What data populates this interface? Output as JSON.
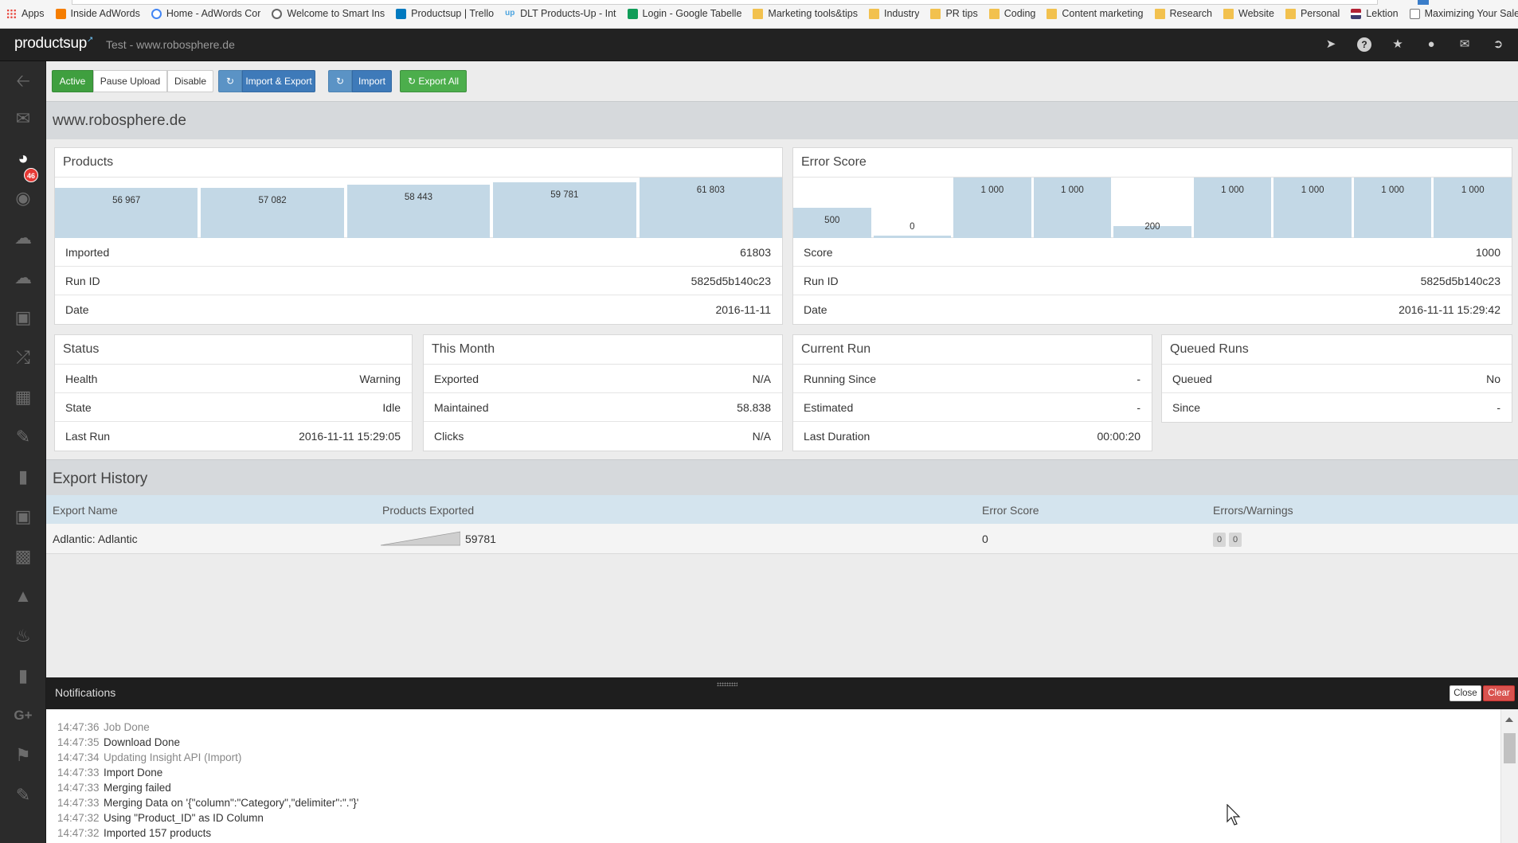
{
  "bookmarks": [
    {
      "label": "Apps",
      "icon": "apps-icon"
    },
    {
      "label": "Inside AdWords",
      "icon": "blogger-icon"
    },
    {
      "label": "Home - AdWords Cor",
      "icon": "google-icon"
    },
    {
      "label": "Welcome to Smart Ins",
      "icon": "smart-icon"
    },
    {
      "label": "Productsup | Trello",
      "icon": "trello-icon"
    },
    {
      "label": "DLT Products-Up - Int",
      "icon": "productsup-icon"
    },
    {
      "label": "Login - Google Tabelle",
      "icon": "sheets-icon"
    },
    {
      "label": "Marketing tools&tips",
      "icon": "folder-icon"
    },
    {
      "label": "Industry",
      "icon": "folder-icon"
    },
    {
      "label": "PR tips",
      "icon": "folder-icon"
    },
    {
      "label": "Coding",
      "icon": "folder-icon"
    },
    {
      "label": "Content marketing",
      "icon": "folder-icon"
    },
    {
      "label": "Research",
      "icon": "folder-icon"
    },
    {
      "label": "Website",
      "icon": "folder-icon"
    },
    {
      "label": "Personal",
      "icon": "folder-icon"
    },
    {
      "label": "Lektion",
      "icon": "flag-icon"
    },
    {
      "label": "Maximizing Your Sale",
      "icon": "document-icon"
    }
  ],
  "app": {
    "logo": "productsup",
    "logo_mark": "↗",
    "subtitle": "Test - www.robosphere.de",
    "top_icons": [
      "location-arrow-icon",
      "help-icon",
      "star-icon",
      "user-icon",
      "mail-icon",
      "logout-icon"
    ]
  },
  "sidebar": {
    "items": [
      "back-arrow-icon",
      "mail-icon",
      "dashboard-icon",
      "lock-icon",
      "cloud-download-icon",
      "cloud-upload-icon",
      "image-icon",
      "shuffle-icon",
      "table-icon",
      "pencil-icon",
      "book-icon",
      "money-icon",
      "bar-chart-icon",
      "warning-icon",
      "bell-icon",
      "book-alt-icon",
      "google-plus-icon",
      "flag-icon",
      "edit-icon"
    ],
    "mail_badge": "46"
  },
  "toolbar": {
    "active": "Active",
    "pause": "Pause Upload",
    "disable": "Disable",
    "import_export": "Import & Export",
    "import": "Import",
    "export_all": "Export All"
  },
  "site_title": "www.robosphere.de",
  "products": {
    "title": "Products",
    "rows": [
      {
        "k": "Imported",
        "v": "61803"
      },
      {
        "k": "Run ID",
        "v": "5825d5b140c23"
      },
      {
        "k": "Date",
        "v": "2016-11-11"
      }
    ]
  },
  "error_score": {
    "title": "Error Score",
    "rows": [
      {
        "k": "Score",
        "v": "1000"
      },
      {
        "k": "Run ID",
        "v": "5825d5b140c23"
      },
      {
        "k": "Date",
        "v": "2016-11-11 15:29:42"
      }
    ]
  },
  "status": {
    "title": "Status",
    "rows": [
      {
        "k": "Health",
        "v": "Warning"
      },
      {
        "k": "State",
        "v": "Idle"
      },
      {
        "k": "Last Run",
        "v": "2016-11-11 15:29:05"
      }
    ]
  },
  "this_month": {
    "title": "This Month",
    "rows": [
      {
        "k": "Exported",
        "v": "N/A"
      },
      {
        "k": "Maintained",
        "v": "58.838"
      },
      {
        "k": "Clicks",
        "v": "N/A"
      }
    ]
  },
  "current_run": {
    "title": "Current Run",
    "rows": [
      {
        "k": "Running Since",
        "v": "-"
      },
      {
        "k": "Estimated",
        "v": "-"
      },
      {
        "k": "Last Duration",
        "v": "00:00:20"
      }
    ]
  },
  "queued_runs": {
    "title": "Queued Runs",
    "rows": [
      {
        "k": "Queued",
        "v": "No"
      },
      {
        "k": "Since",
        "v": "-"
      }
    ]
  },
  "export_history": {
    "title": "Export History",
    "headers": [
      "Export Name",
      "Products Exported",
      "Error Score",
      "Errors/Warnings"
    ],
    "rows": [
      {
        "name": "Adlantic: Adlantic",
        "exported": "59781",
        "error_score": "0",
        "errors": "0",
        "warnings": "0"
      }
    ]
  },
  "notifications": {
    "title": "Notifications",
    "close": "Close",
    "clear": "Clear",
    "log": [
      {
        "t": "14:47:36",
        "m": "Job Done",
        "muted": true
      },
      {
        "t": "14:47:35",
        "m": "Download Done",
        "muted": false
      },
      {
        "t": "14:47:34",
        "m": "Updating Insight API (Import)",
        "muted": true
      },
      {
        "t": "14:47:33",
        "m": "Import Done",
        "muted": false
      },
      {
        "t": "14:47:33",
        "m": "Merging failed",
        "muted": false
      },
      {
        "t": "14:47:33",
        "m": "Merging Data on '{\"column\":\"Category\",\"delimiter\":\".\"}'",
        "muted": false
      },
      {
        "t": "14:47:32",
        "m": "Using \"Product_ID\" as ID Column",
        "muted": false
      },
      {
        "t": "14:47:32",
        "m": "Imported 157 products",
        "muted": false
      }
    ]
  },
  "chart_data": [
    {
      "type": "bar",
      "title": "Products",
      "categories": [
        "1",
        "2",
        "3",
        "4",
        "5"
      ],
      "values": [
        56967,
        57082,
        58443,
        59781,
        61803
      ],
      "labels": [
        "56 967",
        "57 082",
        "58 443",
        "59 781",
        "61 803"
      ],
      "ylim": [
        0,
        61803
      ]
    },
    {
      "type": "bar",
      "title": "Error Score",
      "categories": [
        "1",
        "2",
        "3",
        "4",
        "5",
        "6",
        "7",
        "8",
        "9"
      ],
      "values": [
        500,
        0,
        1000,
        1000,
        200,
        1000,
        1000,
        1000,
        1000
      ],
      "labels": [
        "500",
        "0",
        "1 000",
        "1 000",
        "200",
        "1 000",
        "1 000",
        "1 000",
        "1 000"
      ],
      "ylim": [
        0,
        1000
      ]
    }
  ]
}
